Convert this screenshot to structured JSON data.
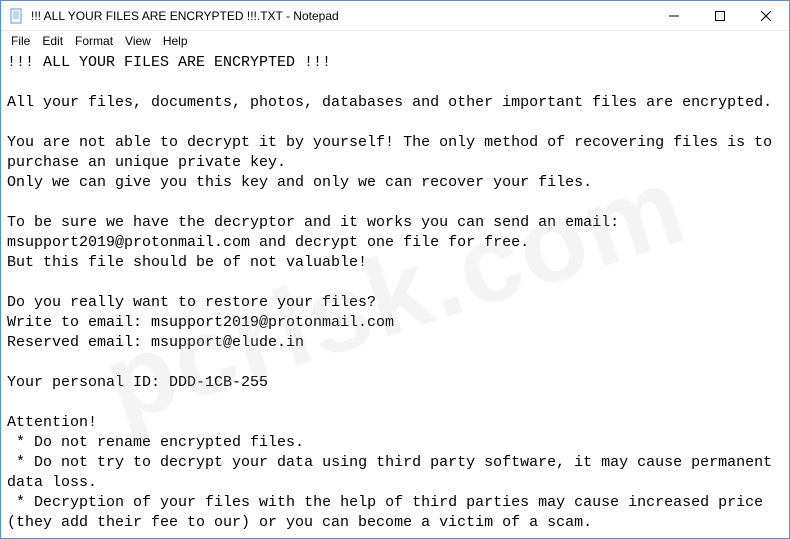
{
  "titlebar": {
    "title": "!!! ALL YOUR FILES ARE ENCRYPTED !!!.TXT - Notepad"
  },
  "menubar": {
    "items": [
      "File",
      "Edit",
      "Format",
      "View",
      "Help"
    ]
  },
  "content": {
    "text": "!!! ALL YOUR FILES ARE ENCRYPTED !!!\n\nAll your files, documents, photos, databases and other important files are encrypted.\n\nYou are not able to decrypt it by yourself! The only method of recovering files is to purchase an unique private key.\nOnly we can give you this key and only we can recover your files.\n\nTo be sure we have the decryptor and it works you can send an email: msupport2019@protonmail.com and decrypt one file for free.\nBut this file should be of not valuable!\n\nDo you really want to restore your files?\nWrite to email: msupport2019@protonmail.com\nReserved email: msupport@elude.in\n\nYour personal ID: DDD-1CB-255\n\nAttention!\n * Do not rename encrypted files.\n * Do not try to decrypt your data using third party software, it may cause permanent data loss.\n * Decryption of your files with the help of third parties may cause increased price (they add their fee to our) or you can become a victim of a scam."
  },
  "watermark": "pcrisk.com"
}
